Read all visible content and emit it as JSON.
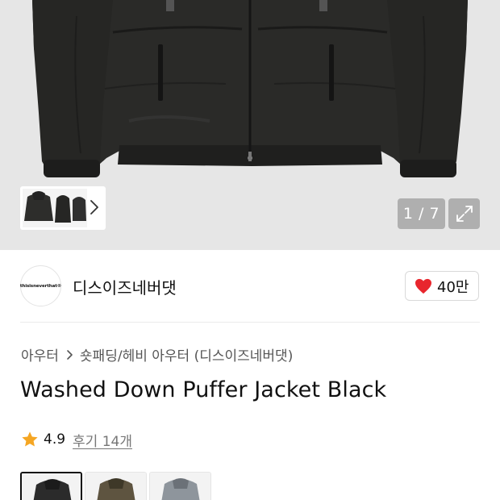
{
  "gallery": {
    "counter": "1 / 7",
    "expand_icon": "expand-icon",
    "next_icon": "chevron-right-icon"
  },
  "brand": {
    "logo_text": "thisisneverthat®",
    "name": "디스이즈네버댓",
    "likes": "40만",
    "like_icon": "heart-icon"
  },
  "product": {
    "breadcrumb": [
      "아우터",
      "숏패딩/헤비 아우터 (디스이즈네버댓)"
    ],
    "title": "Washed Down Puffer Jacket Black",
    "rating": "4.9",
    "reviews": "후기 14개"
  },
  "swatches": [
    {
      "name": "Black",
      "color": "#2b2b2b",
      "selected": true
    },
    {
      "name": "Olive",
      "color": "#5e5440",
      "selected": false
    },
    {
      "name": "Grey",
      "color": "#8e959c",
      "selected": false
    }
  ],
  "colors": {
    "heart": "#e8262d",
    "star": "#f5a623",
    "hero_bg": "#e6e6e6"
  }
}
